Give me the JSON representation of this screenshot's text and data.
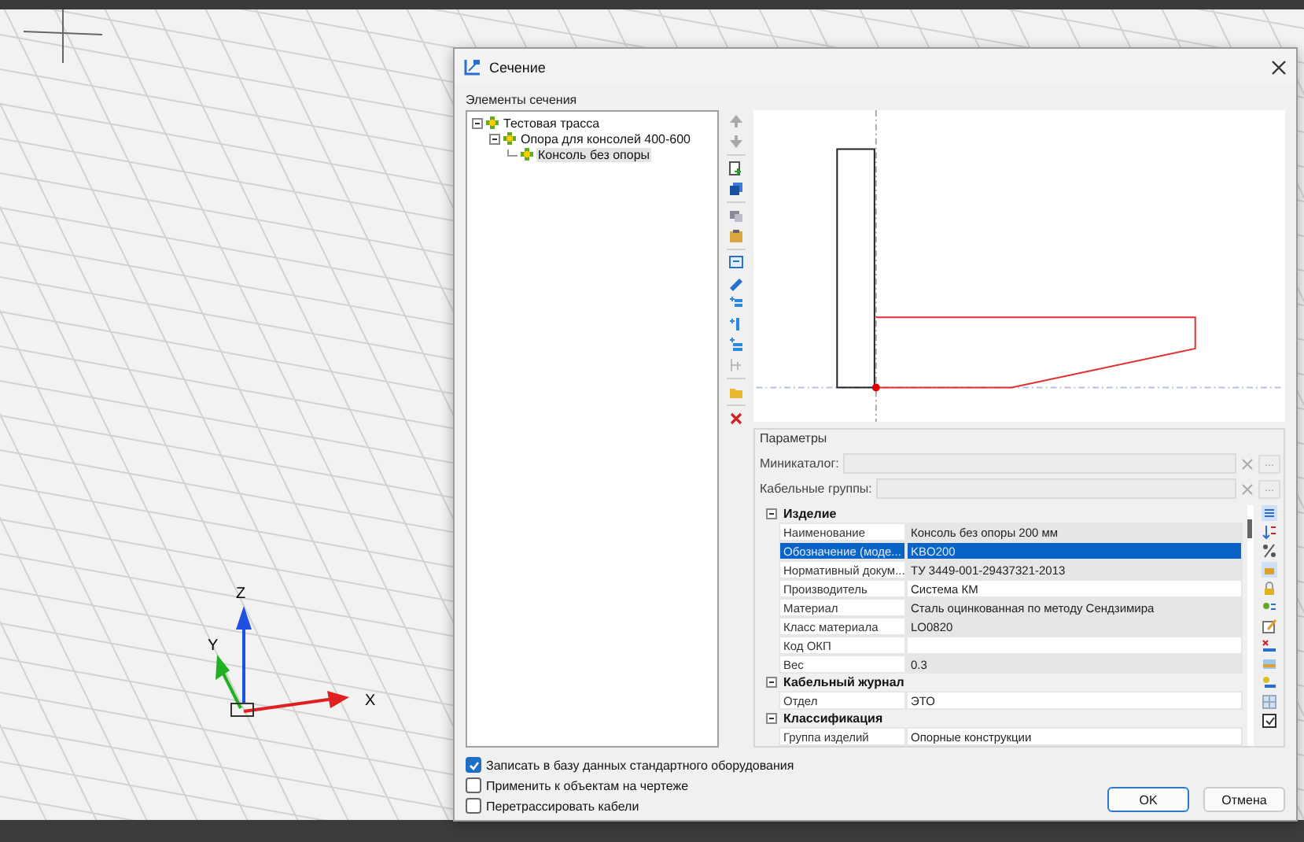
{
  "viewport": {
    "axes": [
      {
        "label": "Z"
      },
      {
        "label": "Y"
      },
      {
        "label": "X"
      }
    ]
  },
  "window": {
    "title": "Сечение"
  },
  "tree_label": "Элементы сечения",
  "tree": [
    {
      "label": "Тестовая трасса",
      "expanded": true,
      "selected": false,
      "children": [
        {
          "label": "Опора для консолей 400-600",
          "expanded": true,
          "selected": false,
          "children": [
            {
              "label": "Консоль без опоры",
              "selected": true
            }
          ]
        }
      ]
    }
  ],
  "parameters": {
    "title": "Параметры",
    "fields": [
      {
        "label": "Миникаталог:",
        "browse": "..."
      },
      {
        "label": "Кабельные группы:",
        "browse": "..."
      }
    ],
    "categories": [
      {
        "title": "Изделие",
        "expanded": true,
        "rows": [
          {
            "name": "Наименование",
            "value": "Консоль без опоры 200 мм",
            "readonly": true,
            "selected": false
          },
          {
            "name": "Обозначение (моде...",
            "value": "KBO200",
            "readonly": true,
            "selected": true
          },
          {
            "name": "Нормативный докум...",
            "value": "ТУ 3449-001-29437321-2013",
            "readonly": true,
            "selected": false
          },
          {
            "name": "Производитель",
            "value": "Система КМ",
            "readonly": false,
            "selected": false
          },
          {
            "name": "Материал",
            "value": "Сталь оцинкованная по методу Сендзимира",
            "readonly": true,
            "selected": false
          },
          {
            "name": "Класс материала",
            "value": "LO0820",
            "readonly": true,
            "selected": false
          },
          {
            "name": "Код ОКП",
            "value": "",
            "readonly": false,
            "selected": false
          },
          {
            "name": "Вес",
            "value": "0.3",
            "readonly": true,
            "selected": false
          }
        ]
      },
      {
        "title": "Кабельный журнал",
        "expanded": true,
        "rows": [
          {
            "name": "Отдел",
            "value": "ЭТО",
            "readonly": false,
            "selected": false
          }
        ]
      },
      {
        "title": "Классификация",
        "expanded": true,
        "rows": [
          {
            "name": "Группа изделий",
            "value": "Опорные конструкции",
            "readonly": false,
            "selected": false
          }
        ]
      }
    ]
  },
  "checkboxes": [
    {
      "label": "Записать в базу данных стандартного оборудования",
      "checked": true
    },
    {
      "label": "Применить к объектам на чертеже",
      "checked": false
    },
    {
      "label": "Перетрассировать кабели",
      "checked": false
    }
  ],
  "buttons": [
    {
      "label": "OK",
      "default": true
    },
    {
      "label": "Отмена",
      "default": false
    }
  ]
}
